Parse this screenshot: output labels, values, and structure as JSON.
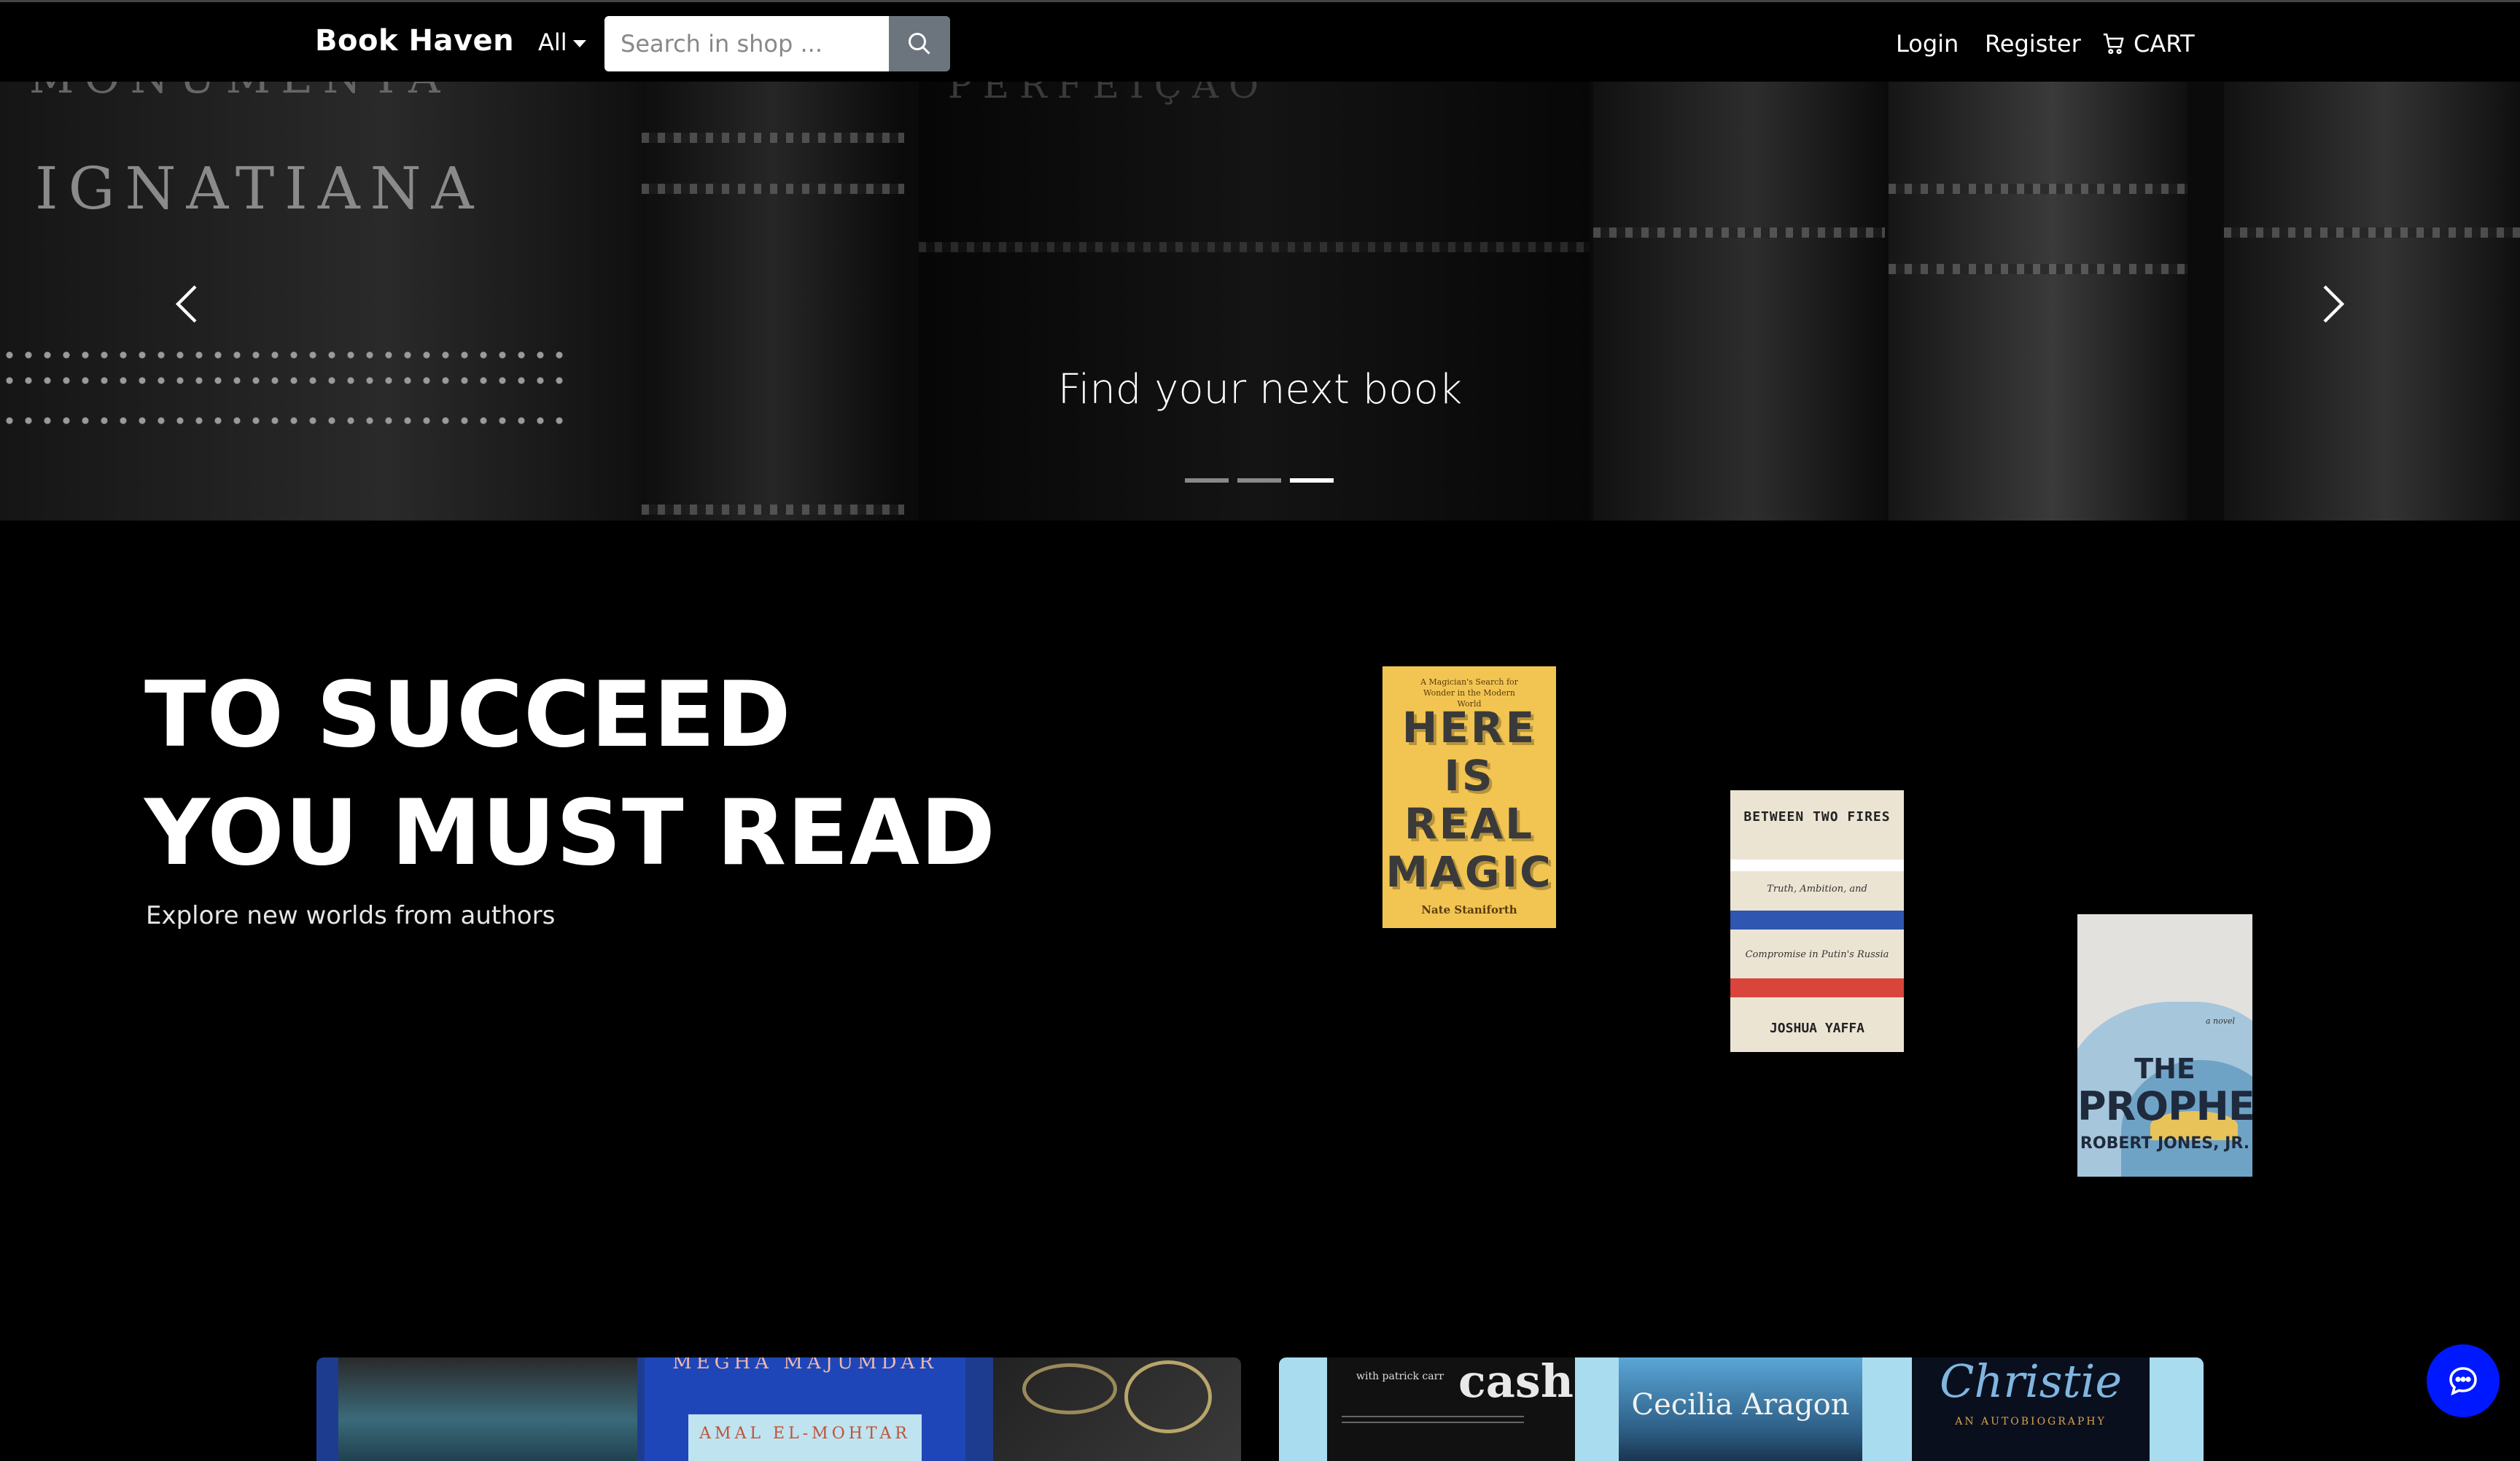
{
  "navbar": {
    "brand": "Book Haven",
    "category_label": "All",
    "search_placeholder": "Search in shop ...",
    "login": "Login",
    "register": "Register",
    "cart": "CART"
  },
  "carousel": {
    "caption": "Find your next book",
    "spine_text": [
      "IGNATIANA",
      "MONUMENTA",
      "PERFEIÇÃO"
    ],
    "slides_count": 3,
    "active_slide": 3
  },
  "hero": {
    "title_line1": "TO SUCCEED",
    "title_line2": "YOU MUST READ",
    "subtitle": "Explore new worlds from authors"
  },
  "books": [
    {
      "tagline": "A Magician's Search for Wonder in the Modern World",
      "title_words": [
        "HERE",
        "IS",
        "REAL",
        "MAGIC"
      ],
      "author": "Nate Staniforth"
    },
    {
      "title": "BETWEEN TWO FIRES",
      "subtitle_top": "Truth, Ambition, and",
      "subtitle_bottom": "Compromise in Putin's Russia",
      "author": "JOSHUA YAFFA"
    },
    {
      "label": "a novel",
      "title_the": "THE",
      "title": "PROPHETS",
      "author": "ROBERT JONES, JR."
    }
  ],
  "promos": {
    "left": {
      "cover_texts": [
        "MEGHA MAJUMDAR",
        "AMAL EL-MOHTAR"
      ]
    },
    "right": {
      "cover_texts": [
        "with patrick carr",
        "cash",
        "Cecilia Aragon",
        "Christie",
        "AN AUTOBIOGRAPHY"
      ]
    }
  },
  "colors": {
    "background": "#000000",
    "search_button": "#6c757d",
    "chat_button": "#0018ff",
    "promo_right_bg": "#a9dcef",
    "promo_left_bg": "#1e3c8f"
  },
  "icons": {
    "search": "search-icon",
    "cart": "cart-icon",
    "prev": "chevron-left-icon",
    "next": "chevron-right-icon",
    "chat": "chat-icon"
  }
}
